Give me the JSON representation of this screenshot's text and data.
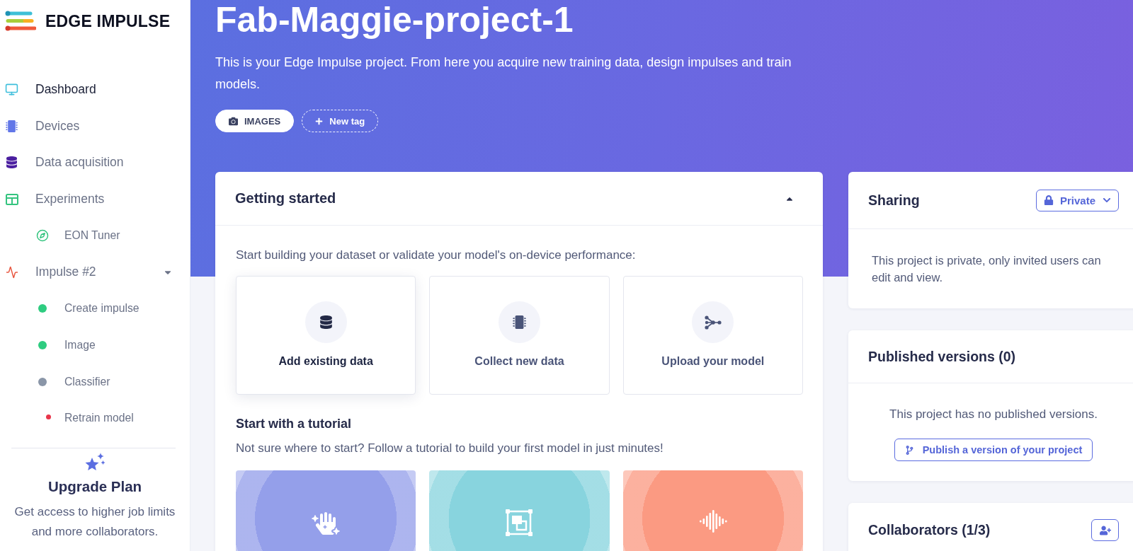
{
  "sidebar": {
    "logo": "EDGE IMPULSE",
    "items": [
      {
        "label": "Dashboard",
        "selected": true
      },
      {
        "label": "Devices",
        "selected": false
      },
      {
        "label": "Data acquisition",
        "selected": false
      },
      {
        "label": "Experiments",
        "selected": false,
        "children": [
          {
            "label": "EON Tuner",
            "kind": "icon",
            "selected": false,
            "alert": false
          }
        ]
      },
      {
        "label": "Impulse #2",
        "selected": false,
        "expanded": true,
        "children": [
          {
            "label": "Create impulse",
            "kind": "status",
            "color": "#2ecc80",
            "selected": false,
            "alert": false
          },
          {
            "label": "Image",
            "kind": "status",
            "color": "#2ecc80",
            "selected": false,
            "alert": false
          },
          {
            "label": "Classifier",
            "kind": "status",
            "color": "#8a96a8",
            "selected": false,
            "alert": false
          },
          {
            "label": "Retrain model",
            "kind": "icon",
            "selected": false,
            "alert": true
          }
        ]
      }
    ],
    "upgrade": {
      "title": "Upgrade Plan",
      "text": "Get access to higher job limits and more collaborators."
    }
  },
  "header": {
    "title": "Fab-Maggie-project-1",
    "description": "This is your Edge Impulse project. From here you acquire new training data, design impulses and train models.",
    "tags": [
      {
        "label": "IMAGES",
        "kind": "category"
      },
      {
        "label": "New tag",
        "kind": "add"
      }
    ]
  },
  "getting_started": {
    "title": "Getting started",
    "expanded": true,
    "intro": "Start building your dataset or validate your model's on-device performance:",
    "options": [
      {
        "label": "Add existing data",
        "selected": true
      },
      {
        "label": "Collect new data",
        "selected": false
      },
      {
        "label": "Upload your model",
        "selected": false
      }
    ],
    "tutorial": {
      "title": "Start with a tutorial",
      "text": "Not sure where to start? Follow a tutorial to build your first model in just minutes!",
      "cards": [
        {
          "color": "#949fea"
        },
        {
          "color": "#88d4de"
        },
        {
          "color": "#fb9a82"
        }
      ]
    }
  },
  "sharing": {
    "title": "Sharing",
    "visibility": "Private",
    "text": "This project is private, only invited users can edit and view."
  },
  "published_versions": {
    "title": "Published versions (0)",
    "text": "This project has no published versions.",
    "button": "Publish a version of your project"
  },
  "collaborators": {
    "title": "Collaborators (1/3)"
  }
}
